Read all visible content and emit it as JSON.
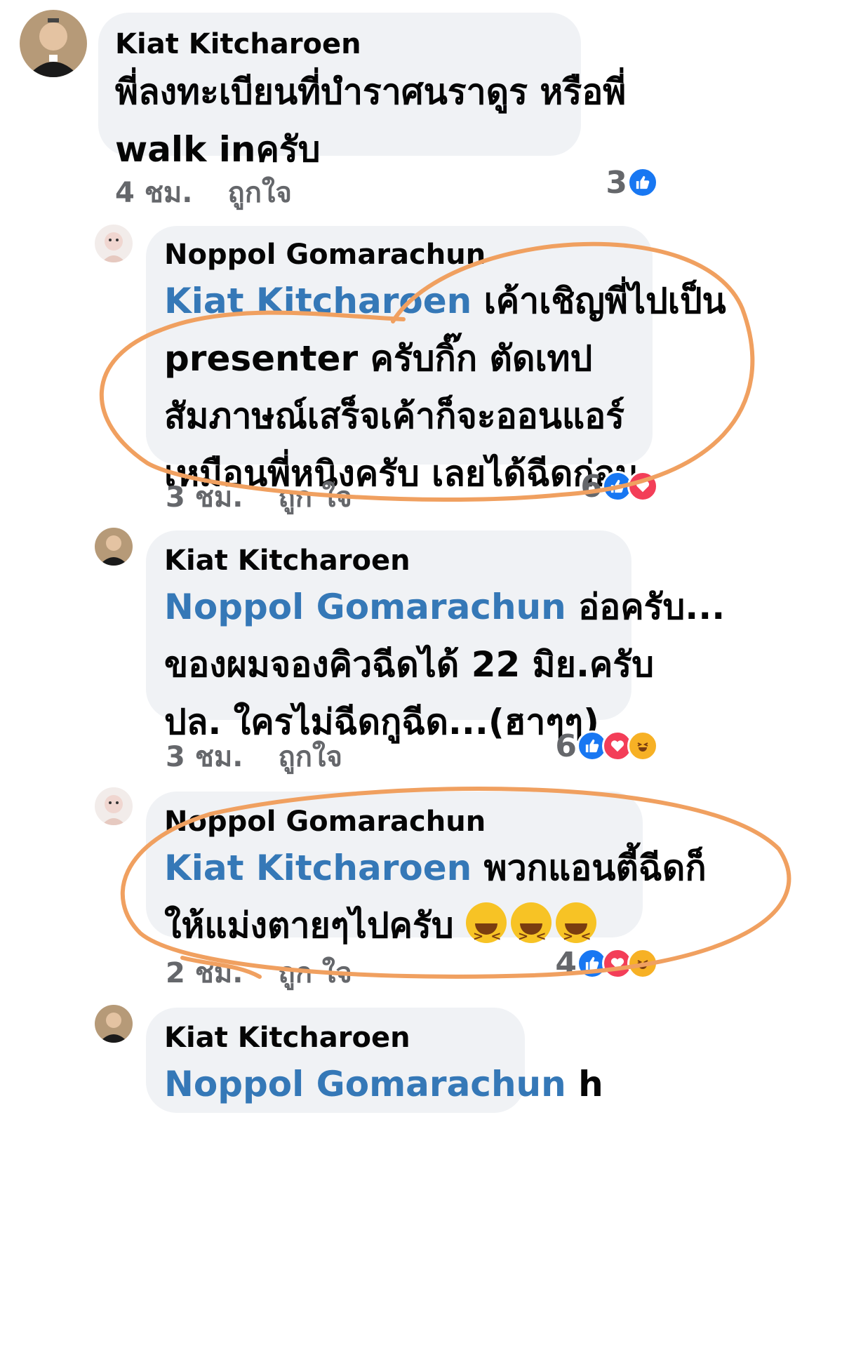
{
  "comments": [
    {
      "author": "Kiat Kitcharoen",
      "lines": [
        "พี่ลงทะเบียนที่บำราศนราดูร หรือพี่",
        "walk inครับ"
      ],
      "time": "4 ชม.",
      "like_label": "ถูกใจ",
      "reaction_count": "3",
      "reactions": [
        "like"
      ]
    },
    {
      "author": "Noppol Gomarachun",
      "mention": "Kiat Kitcharoen",
      "first_line_rest": "เค้าเชิญพี่ไปเป็น",
      "lines": [
        "presenter ครับกิ๊ก ตัดเทป",
        "สัมภาษณ์เสร็จเค้าก็จะออนแอร์",
        "เหมือนพี่หนิงครับ เลยได้ฉีดก่อน"
      ],
      "time": "3 ชม.",
      "like_label": "ถูก ใจ",
      "reaction_count": "6",
      "reactions": [
        "like",
        "love"
      ]
    },
    {
      "author": "Kiat Kitcharoen",
      "mention": "Noppol Gomarachun",
      "first_line_rest": "อ่อครับ...",
      "lines": [
        "ของผมจองคิวฉีดได้ 22 มิย.ครับ",
        "ปล. ใครไม่ฉีดกูฉีด...(ฮาๆๆ)"
      ],
      "time": "3 ชม.",
      "like_label": "ถูกใจ",
      "reaction_count": "6",
      "reactions": [
        "like",
        "love",
        "haha"
      ]
    },
    {
      "author": "Noppol Gomarachun",
      "mention": "Kiat Kitcharoen",
      "first_line_rest": "พวกแอนตี้ฉีดก็",
      "lines": [
        "ให้แม่งตายๆไปครับ"
      ],
      "emoji_name": "laughing-emoji",
      "time": "2 ชม.",
      "like_label": "ถูก ใจ",
      "reaction_count": "4",
      "reactions": [
        "like",
        "love",
        "haha"
      ]
    },
    {
      "author": "Kiat Kitcharoen",
      "mention": "Noppol Gomarachun",
      "first_line_rest": "h"
    }
  ],
  "colors": {
    "bubble": "#f0f2f5",
    "mention": "#3578b7",
    "annotation": "#f0a060",
    "like": "#1877f2",
    "love": "#f33e58",
    "haha": "#f7b125"
  }
}
